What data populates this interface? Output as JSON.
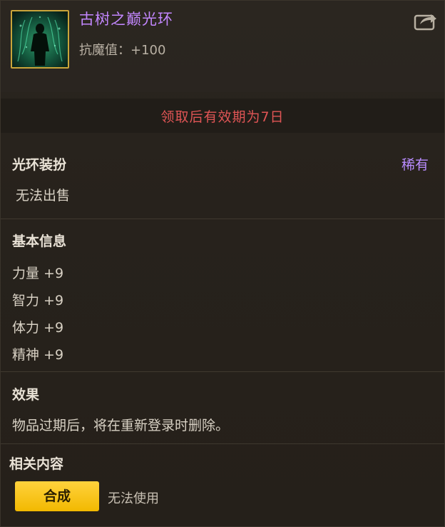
{
  "item": {
    "name": "古树之巅光环",
    "stat": "抗魔值：+100",
    "icon": "ancient-tree-aura-icon",
    "name_color": "#c387ff"
  },
  "expiry": {
    "text": "领取后有效期为7日",
    "color": "#e05555"
  },
  "category": {
    "title": "光环装扮",
    "rarity": "稀有",
    "rarity_color": "#b98cff",
    "sell_note": "无法出售"
  },
  "basic_info": {
    "title": "基本信息",
    "stats": [
      "力量 +9",
      "智力 +9",
      "体力 +9",
      "精神 +9"
    ]
  },
  "effect": {
    "title": "效果",
    "text": "物品过期后，将在重新登录时删除。"
  },
  "related": {
    "title": "相关内容",
    "button_label": "合成",
    "button_color": "#ffd23d",
    "status": "无法使用"
  }
}
